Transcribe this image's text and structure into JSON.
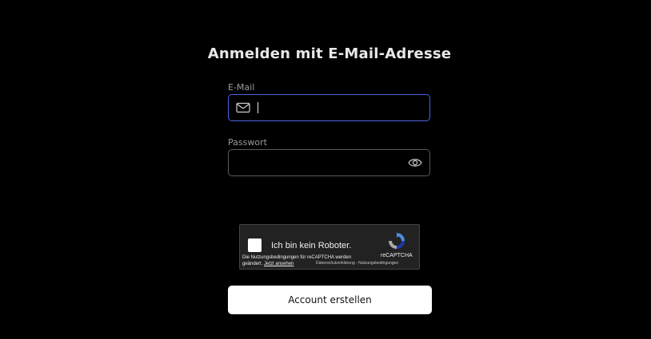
{
  "form": {
    "title": "Anmelden mit E-Mail-Adresse",
    "email_label": "E-Mail",
    "email_value": "",
    "email_icon": "mail-icon",
    "password_label": "Passwort",
    "password_value": "",
    "password_icon": "eye-icon",
    "submit_label": "Account erstellen"
  },
  "captcha": {
    "checkbox_label": "Ich bin kein Roboter.",
    "notice_text": "Die Nutzungsbedingungen für reCAPTCHA werden geändert.",
    "notice_link": "Jetzt ansehen",
    "brand": "reCAPTCHA",
    "privacy_links": "Datenschutzerklärung - Nutzungsbedingungen"
  },
  "colors": {
    "background": "#000000",
    "email_focus_border": "#4a63e6",
    "field_border": "#5a5a5a",
    "button_bg": "#ffffff",
    "captcha_bg": "#222222"
  }
}
